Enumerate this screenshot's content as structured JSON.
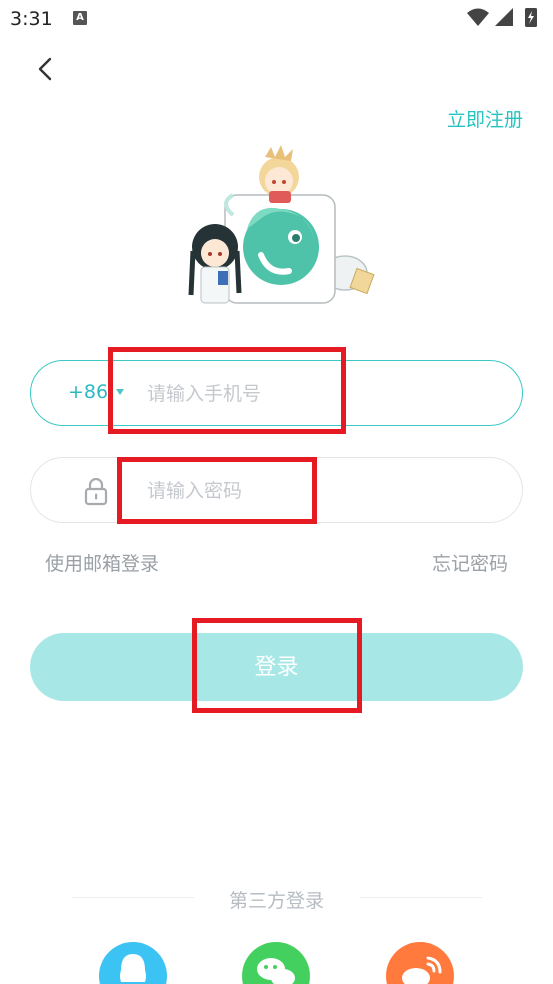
{
  "status_bar": {
    "time": "3:31",
    "notification_icon": "A",
    "icons": [
      "wifi-icon",
      "cell-signal-icon",
      "battery-charging-icon"
    ]
  },
  "header": {
    "back_icon": "chevron-left-icon",
    "register_label": "立即注册"
  },
  "logo": {
    "icon": "app-mascot-logo"
  },
  "form": {
    "country_code": "+86",
    "phone_placeholder": "请输入手机号",
    "password_placeholder": "请输入密码",
    "email_login_label": "使用邮箱登录",
    "forgot_password_label": "忘记密码",
    "login_label": "登录"
  },
  "third_party": {
    "label": "第三方登录",
    "providers": [
      {
        "name": "qq",
        "icon": "qq-icon",
        "color": "#3bc3f4"
      },
      {
        "name": "wechat",
        "icon": "wechat-icon",
        "color": "#44d05f"
      },
      {
        "name": "weibo",
        "icon": "weibo-icon",
        "color": "#ff7a3c"
      }
    ]
  },
  "colors": {
    "accent": "#27c3c0",
    "button_bg": "#a7e8e7",
    "annotation": "#e61a22"
  }
}
